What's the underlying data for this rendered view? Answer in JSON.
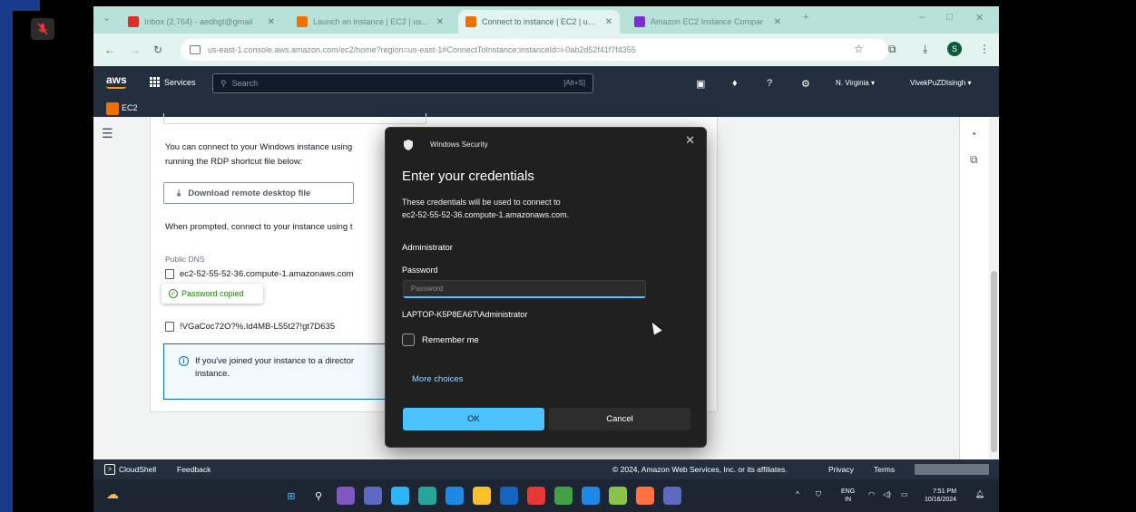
{
  "browser": {
    "tabs": [
      {
        "title": "Inbox (2,764) - aedhgt@gmail",
        "fav_color": "#d93025",
        "active": false
      },
      {
        "title": "Launch an instance | EC2 | us-east-1",
        "fav_color": "#ed7100",
        "active": false
      },
      {
        "title": "Connect to instance | EC2 | us-east-1",
        "fav_color": "#ed7100",
        "active": true
      },
      {
        "title": "Amazon EC2 Instance Compar",
        "fav_color": "#7b2fd1",
        "active": false
      }
    ],
    "new_tab": "+",
    "url": "us-east-1.console.aws.amazon.com/ec2/home?region=us-east-1#ConnectToInstance:instanceId=i-0ab2d52f41f7f4355",
    "avatar_letter": "S"
  },
  "aws": {
    "logo": "aws",
    "services_label": "Services",
    "search_placeholder": "Search",
    "search_shortcut": "[Alt+S]",
    "region": "N. Virginia ▾",
    "account": "VivekPuZDIsingh ▾",
    "service_label": "EC2"
  },
  "panel": {
    "intro_line1": "You can connect to your Windows instance using",
    "intro_line2": "running the RDP shortcut file below:",
    "download_label": "Download remote desktop file",
    "prompt_text": "When prompted, connect to your instance using t",
    "public_dns_label": "Public DNS",
    "public_dns_value": "ec2-52-55-52-36.compute-1.amazonaws.com",
    "toast": "Password copied",
    "password_value": "!VGaCoc72O?%.Id4MB-L55t27!gt7D635",
    "info_line1": "If you've joined your instance to a director",
    "info_line2": "instance."
  },
  "dialog": {
    "caption": "Windows Security",
    "title": "Enter your credentials",
    "desc_line1": "These credentials will be used to connect to",
    "desc_line2": "ec2-52-55-52-36.compute-1.amazonaws.com.",
    "username": "Administrator",
    "password_label": "Password",
    "password_placeholder": "Password",
    "domain_user": "LAPTOP-K5P8EA6T\\Administrator",
    "remember_label": "Remember me",
    "more_choices": "More choices",
    "ok_label": "OK",
    "cancel_label": "Cancel"
  },
  "footer": {
    "cloudshell": "CloudShell",
    "feedback": "Feedback",
    "copyright": "© 2024, Amazon Web Services, Inc. or its affiliates.",
    "privacy": "Privacy",
    "terms": "Terms"
  },
  "taskbar": {
    "lang_line1": "ENG",
    "lang_line2": "IN",
    "time": "7:51 PM",
    "date": "10/16/2024",
    "tray_up": "^"
  }
}
